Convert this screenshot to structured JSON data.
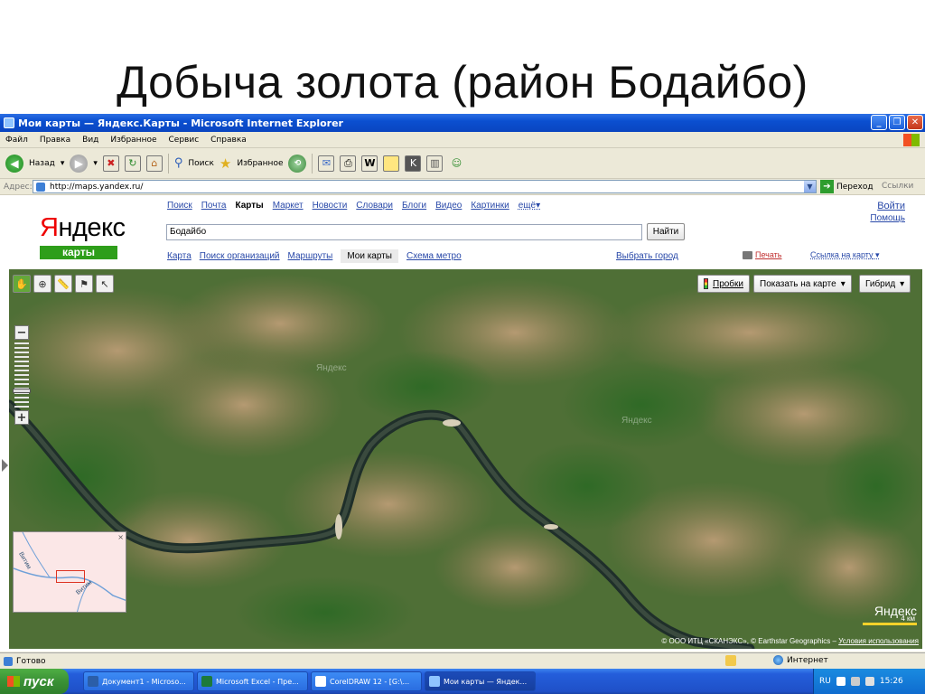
{
  "slide": {
    "title": "Добыча золота (район Бодайбо)"
  },
  "window": {
    "title": "Мои карты — Яндекс.Карты - Microsoft Internet Explorer"
  },
  "menu": [
    "Файл",
    "Правка",
    "Вид",
    "Избранное",
    "Сервис",
    "Справка"
  ],
  "toolbar": {
    "back": "Назад",
    "search": "Поиск",
    "favorites": "Избранное"
  },
  "address": {
    "label": "Адрес:",
    "url": "http://maps.yandex.ru/",
    "go": "Переход",
    "links": "Ссылки"
  },
  "yandex": {
    "logo_first": "Я",
    "logo_rest": "ндекс",
    "logo_sub": "карты",
    "topnav": [
      {
        "label": "Поиск",
        "active": false
      },
      {
        "label": "Почта",
        "active": false
      },
      {
        "label": "Карты",
        "active": true
      },
      {
        "label": "Маркет",
        "active": false
      },
      {
        "label": "Новости",
        "active": false
      },
      {
        "label": "Словари",
        "active": false
      },
      {
        "label": "Блоги",
        "active": false
      },
      {
        "label": "Видео",
        "active": false
      },
      {
        "label": "Картинки",
        "active": false
      }
    ],
    "more": "ещё",
    "login": "Войти",
    "help": "Помощь",
    "search_value": "Бодайбо",
    "search_button": "Найти",
    "subnav": [
      {
        "label": "Карта",
        "active": false
      },
      {
        "label": "Поиск организаций",
        "active": false
      },
      {
        "label": "Маршруты",
        "active": false
      },
      {
        "label": "Мои карты",
        "active": true
      },
      {
        "label": "Схема метро",
        "active": false
      }
    ],
    "choose_city": "Выбрать город",
    "print": "Печать",
    "map_link": "Ссылка на карту"
  },
  "map": {
    "traffic": "Пробки",
    "show_on_map": "Показать на карте",
    "layer": "Гибрид",
    "watermark": "Яндекс",
    "scale": "4 км",
    "copyright": "© ООО ИТЦ «СКАНЭКС», © Earthstar Geographics – ",
    "terms": "Условия использования",
    "minimap_river": "Витим",
    "zoom_level": 0.77
  },
  "status": {
    "text": "Готово",
    "zone": "Интернет"
  },
  "taskbar": {
    "start": "пуск",
    "items": [
      {
        "label": "Документ1 - Microso...",
        "active": false
      },
      {
        "label": "Microsoft Excel - Пре...",
        "active": false
      },
      {
        "label": "CorelDRAW 12 - [G:\\...",
        "active": false
      },
      {
        "label": "Мои карты — Яндек...",
        "active": true
      }
    ],
    "lang": "RU",
    "time": "15:26"
  }
}
